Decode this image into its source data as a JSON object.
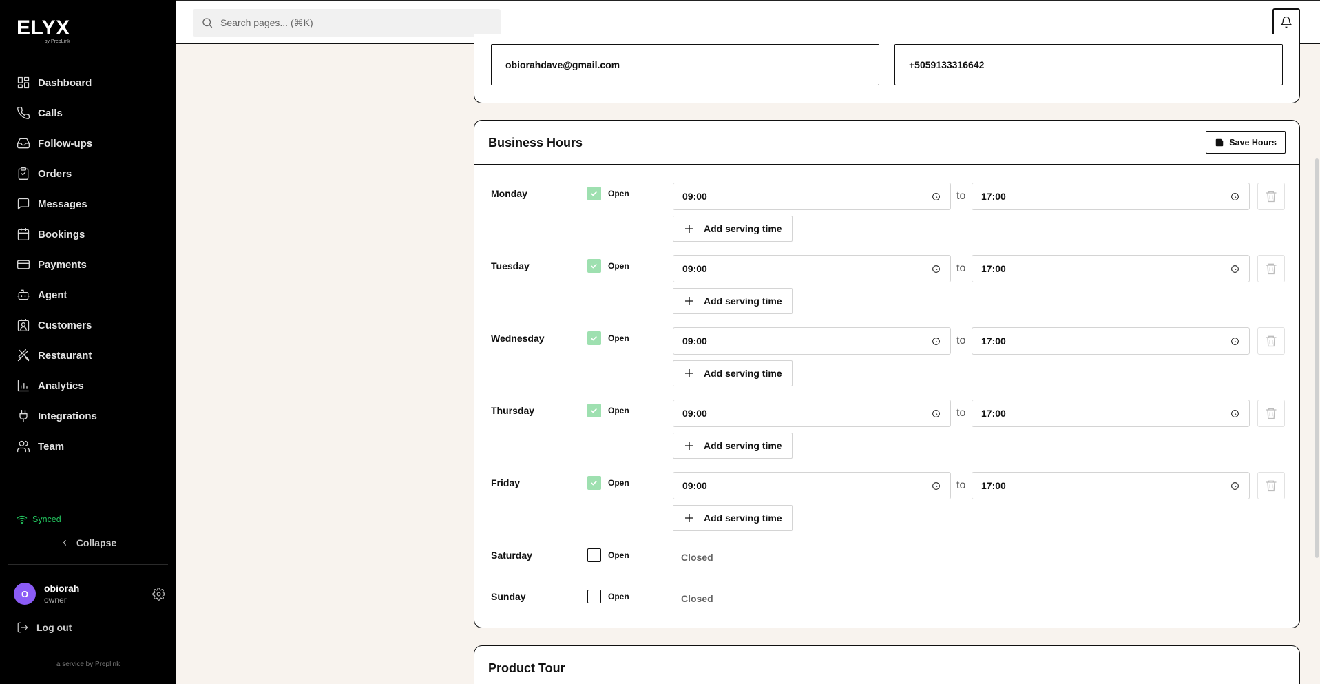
{
  "brand": {
    "logo": "ELYX",
    "sub": "by PrepLink",
    "service": "a service by Preplink"
  },
  "sidebar": {
    "items": [
      {
        "label": "Dashboard",
        "icon": "dashboard-icon"
      },
      {
        "label": "Calls",
        "icon": "phone-icon"
      },
      {
        "label": "Follow-ups",
        "icon": "inbox-icon"
      },
      {
        "label": "Orders",
        "icon": "clipboard-icon"
      },
      {
        "label": "Messages",
        "icon": "message-icon"
      },
      {
        "label": "Bookings",
        "icon": "calendar-icon"
      },
      {
        "label": "Payments",
        "icon": "credit-card-icon"
      },
      {
        "label": "Agent",
        "icon": "bot-icon"
      },
      {
        "label": "Customers",
        "icon": "contact-icon"
      },
      {
        "label": "Restaurant",
        "icon": "utensils-icon"
      },
      {
        "label": "Analytics",
        "icon": "chart-icon"
      },
      {
        "label": "Integrations",
        "icon": "plug-icon"
      },
      {
        "label": "Team",
        "icon": "users-icon"
      }
    ],
    "sync_status": "Synced",
    "collapse_label": "Collapse",
    "user": {
      "initial": "O",
      "name": "obiorah",
      "role": "owner"
    },
    "logout_label": "Log out"
  },
  "header": {
    "search_placeholder": "Search pages... (⌘K)"
  },
  "contact": {
    "email": "obiorahdave@gmail.com",
    "phone": "+5059133316642"
  },
  "business_hours": {
    "title": "Business Hours",
    "save_label": "Save Hours",
    "open_label": "Open",
    "to_label": "to",
    "add_label": "Add serving time",
    "closed_label": "Closed",
    "days": [
      {
        "name": "Monday",
        "open": true,
        "from": "09:00",
        "to": "17:00"
      },
      {
        "name": "Tuesday",
        "open": true,
        "from": "09:00",
        "to": "17:00"
      },
      {
        "name": "Wednesday",
        "open": true,
        "from": "09:00",
        "to": "17:00"
      },
      {
        "name": "Thursday",
        "open": true,
        "from": "09:00",
        "to": "17:00"
      },
      {
        "name": "Friday",
        "open": true,
        "from": "09:00",
        "to": "17:00"
      },
      {
        "name": "Saturday",
        "open": false
      },
      {
        "name": "Sunday",
        "open": false
      }
    ]
  },
  "product_tour": {
    "title": "Product Tour"
  },
  "colors": {
    "sidebar_bg": "#000000",
    "page_bg": "#f8f3ee",
    "synced": "#22c55e",
    "checkbox_on": "#9ee0b0",
    "avatar": "#8b5cf6"
  }
}
